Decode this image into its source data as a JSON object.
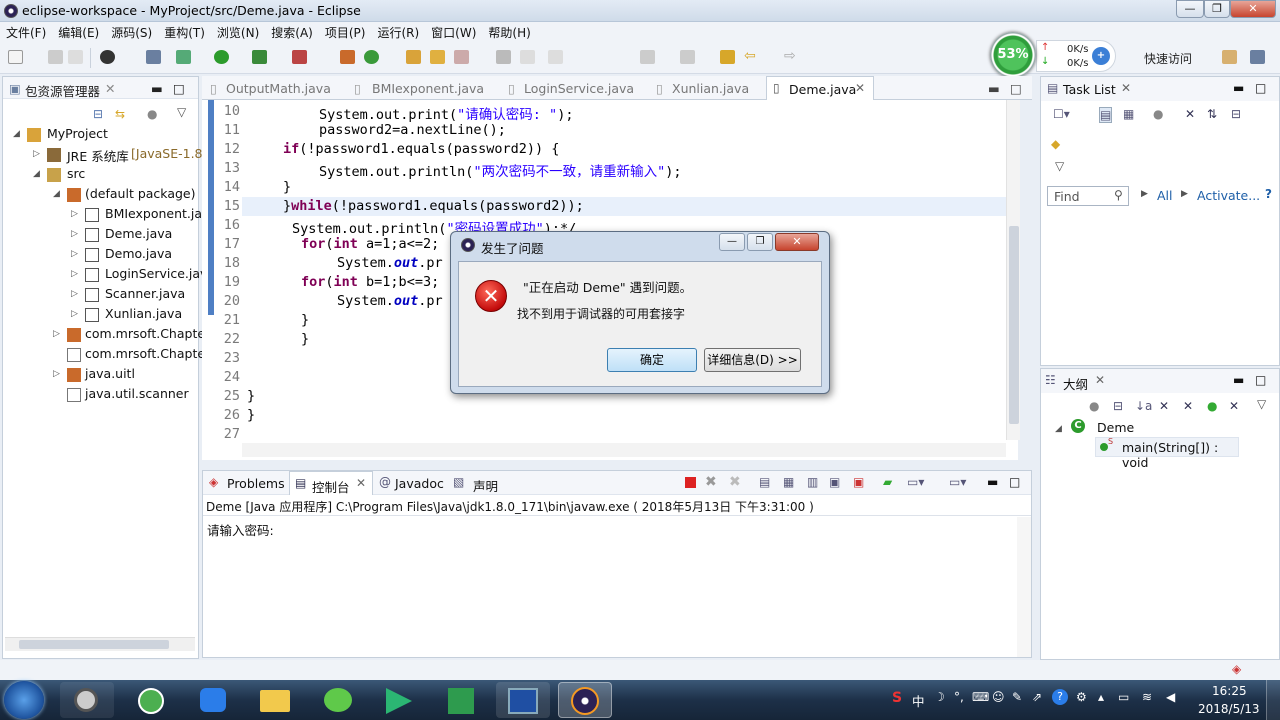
{
  "window": {
    "title": "eclipse-workspace - MyProject/src/Deme.java - Eclipse"
  },
  "menu": [
    "文件(F)",
    "编辑(E)",
    "源码(S)",
    "重构(T)",
    "浏览(N)",
    "搜索(A)",
    "项目(P)",
    "运行(R)",
    "窗口(W)",
    "帮助(H)"
  ],
  "gauge": {
    "percent": "53%",
    "up": "0K/s",
    "down": "0K/s"
  },
  "quick_access": "快速访问",
  "package_explorer": {
    "title": "包资源管理器",
    "items": [
      {
        "label": "MyProject",
        "indent": 0
      },
      {
        "label": "JRE 系统库",
        "extra": "[JavaSE-1.8",
        "indent": 1
      },
      {
        "label": "src",
        "indent": 1
      },
      {
        "label": "(default package)",
        "indent": 2
      },
      {
        "label": "BMIexponent.ja",
        "indent": 3
      },
      {
        "label": "Deme.java",
        "indent": 3
      },
      {
        "label": "Demo.java",
        "indent": 3
      },
      {
        "label": "LoginService.jav",
        "indent": 3
      },
      {
        "label": "Scanner.java",
        "indent": 3
      },
      {
        "label": "Xunlian.java",
        "indent": 3
      },
      {
        "label": "com.mrsoft.Chapte",
        "indent": 2
      },
      {
        "label": "com.mrsoft.Chapte",
        "indent": 2
      },
      {
        "label": "java.uitl",
        "indent": 2
      },
      {
        "label": "java.util.scanner",
        "indent": 2
      }
    ]
  },
  "editor": {
    "tabs": [
      "OutputMath.java",
      "BMIexponent.java",
      "LoginService.java",
      "Xunlian.java",
      "Deme.java"
    ],
    "active_tab": "Deme.java",
    "lines": [
      "10",
      "11",
      "12",
      "13",
      "14",
      "15",
      "16",
      "17",
      "18",
      "19",
      "20",
      "21",
      "22",
      "23",
      "24",
      "25",
      "26",
      "27"
    ]
  },
  "dialog": {
    "title": "发生了问题",
    "message": "\"正在启动 Deme\" 遇到问题。",
    "detail": "找不到用于调试器的可用套接字",
    "ok": "确定",
    "details_button": "详细信息(D) >>"
  },
  "console": {
    "tabs": [
      "Problems",
      "控制台",
      "Javadoc",
      "声明"
    ],
    "header": "Deme [Java 应用程序] C:\\Program Files\\Java\\jdk1.8.0_171\\bin\\javaw.exe ( 2018年5月13日 下午3:31:00 )",
    "output": "请输入密码:"
  },
  "task_list": {
    "title": "Task List",
    "find": "Find",
    "all": "All",
    "activate": "Activate..."
  },
  "outline": {
    "title": "大纲",
    "class": "Deme",
    "method": "main(String[]) : void"
  },
  "taskbar": {
    "time": "16:25",
    "date": "2018/5/13",
    "ime": "中"
  }
}
